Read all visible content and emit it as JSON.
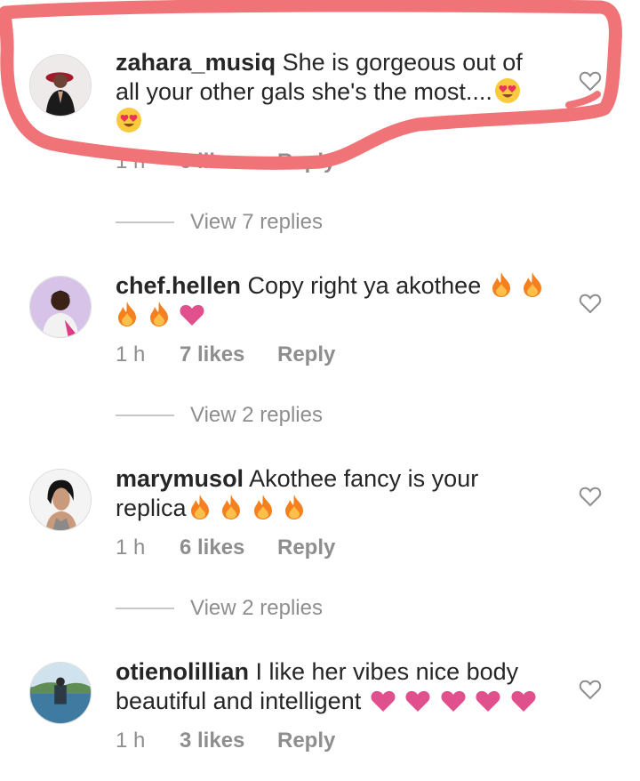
{
  "comments": [
    {
      "username": "zahara_musiq",
      "text": " She is gorgeous out of all your other gals she's the most....",
      "emojis": [
        "heart-eyes",
        "heart-eyes"
      ],
      "time": "1 h",
      "likes": "6 likes",
      "reply": "Reply",
      "view_replies": "View 7 replies"
    },
    {
      "username": "chef.hellen",
      "text": " Copy right ya akothee",
      "emojis": [
        "fire",
        "fire",
        "fire",
        "fire",
        "pink-heart"
      ],
      "time": "1 h",
      "likes": "7 likes",
      "reply": "Reply",
      "view_replies": "View 2 replies"
    },
    {
      "username": "marymusol",
      "text": " Akothee fancy is your replica",
      "emojis": [
        "fire",
        "fire",
        "fire",
        "fire"
      ],
      "time": "1 h",
      "likes": "6 likes",
      "reply": "Reply",
      "view_replies": "View 2 replies"
    },
    {
      "username": "otienolillian",
      "text": " I like her vibes nice body beautiful and intelligent",
      "emojis": [
        "pink-heart",
        "pink-heart",
        "pink-heart",
        "pink-heart",
        "pink-heart"
      ],
      "time": "1 h",
      "likes": "3 likes",
      "reply": "Reply"
    }
  ],
  "colors": {
    "highlight_stroke": "#f07378",
    "meta_gray": "#8e8e8e",
    "pink_heart": "#e0508c",
    "fire_orange": "#f4801f"
  }
}
